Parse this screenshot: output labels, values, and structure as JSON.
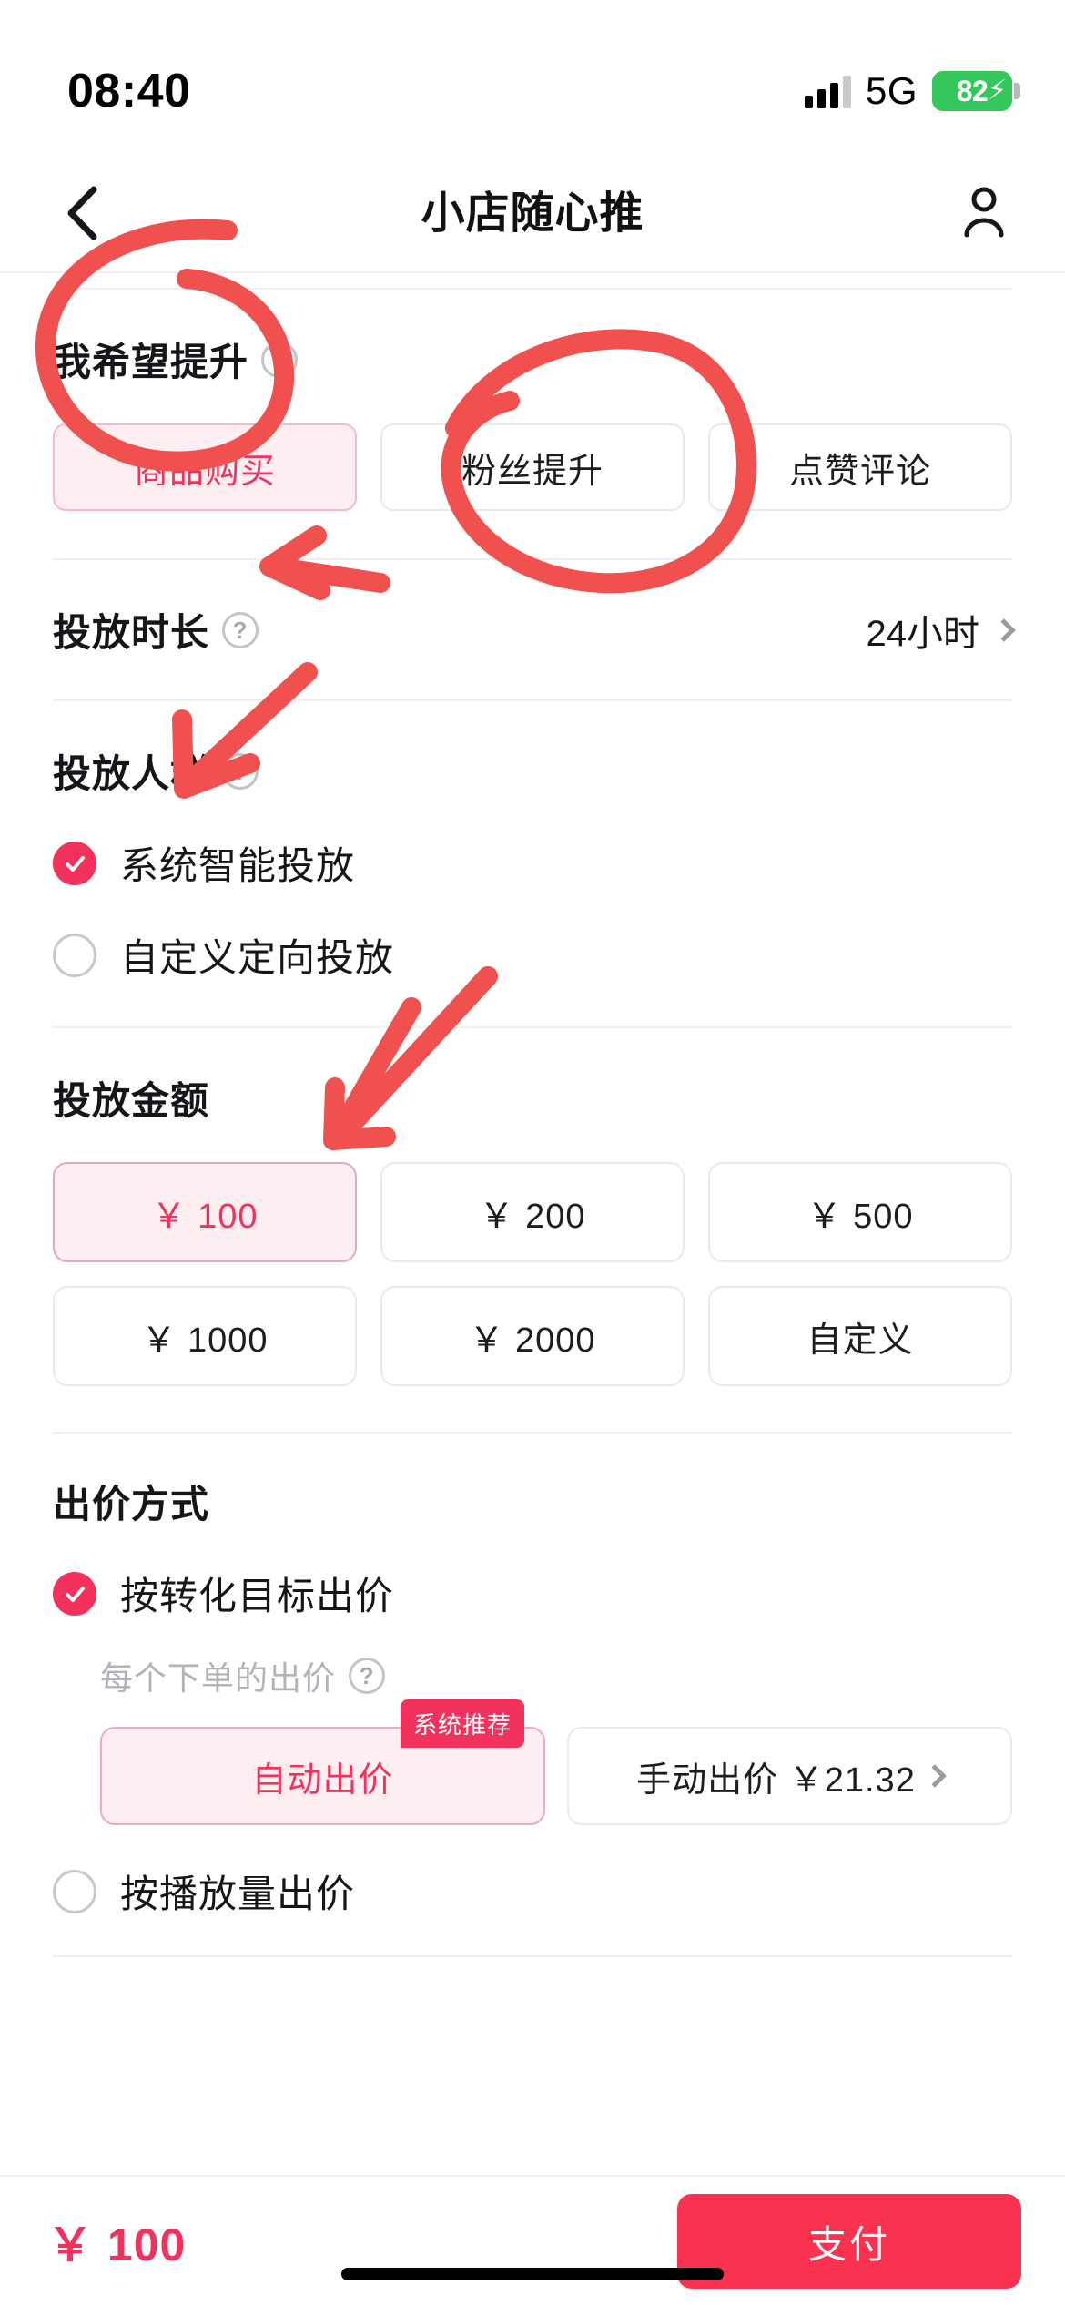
{
  "status_bar": {
    "time": "08:40",
    "network": "5G",
    "battery_percent": "82",
    "battery_charging": true,
    "signal_icon": "signal-bars-icon",
    "battery_icon": "battery-icon"
  },
  "nav": {
    "back_icon": "chevron-left-icon",
    "title": "小店随心推",
    "profile_icon": "person-icon"
  },
  "sections": {
    "goal": {
      "title": "我希望提升",
      "help_icon": "question-mark-icon",
      "options": [
        {
          "label": "商品购买",
          "selected": true
        },
        {
          "label": "粉丝提升",
          "selected": false
        },
        {
          "label": "点赞评论",
          "selected": false
        }
      ]
    },
    "duration": {
      "title": "投放时长",
      "help_icon": "question-mark-icon",
      "value": "24小时",
      "chevron_icon": "chevron-right-icon"
    },
    "audience": {
      "title": "投放人群",
      "help_icon": "question-mark-icon",
      "options": [
        {
          "label": "系统智能投放",
          "selected": true
        },
        {
          "label": "自定义定向投放",
          "selected": false
        }
      ]
    },
    "budget": {
      "title": "投放金额",
      "options": [
        {
          "label": "￥ 100",
          "selected": true
        },
        {
          "label": "￥ 200",
          "selected": false
        },
        {
          "label": "￥ 500",
          "selected": false
        },
        {
          "label": "￥ 1000",
          "selected": false
        },
        {
          "label": "￥ 2000",
          "selected": false
        },
        {
          "label": "自定义",
          "selected": false
        }
      ]
    },
    "bidding": {
      "title": "出价方式",
      "modes": [
        {
          "label": "按转化目标出价",
          "selected": true
        },
        {
          "label": "按播放量出价",
          "selected": false
        }
      ],
      "bid_sub_label": "每个下单的出价",
      "bid_sub_help_icon": "question-mark-icon",
      "recommend_badge": "系统推荐",
      "auto_bid": {
        "label": "自动出价",
        "selected": true
      },
      "manual_bid": {
        "label": "手动出价 ￥21.32",
        "selected": false,
        "chevron_icon": "chevron-right-icon"
      }
    }
  },
  "bottom_bar": {
    "total": "￥ 100",
    "pay_label": "支付"
  },
  "annotations": {
    "color": "#f1514e",
    "marks": [
      "circle-around-goal-selected-chip",
      "circle-around-duration-value",
      "arrow-to-audience-system-option",
      "arrow-to-budget-100-option",
      "double-arrow-to-auto-bid-option"
    ]
  },
  "colors": {
    "accent_pink": "#f2325c",
    "pay_red": "#f9324f",
    "selected_bg": "#fdeef2",
    "annotation_red": "#f1514e",
    "battery_green": "#34c759"
  }
}
